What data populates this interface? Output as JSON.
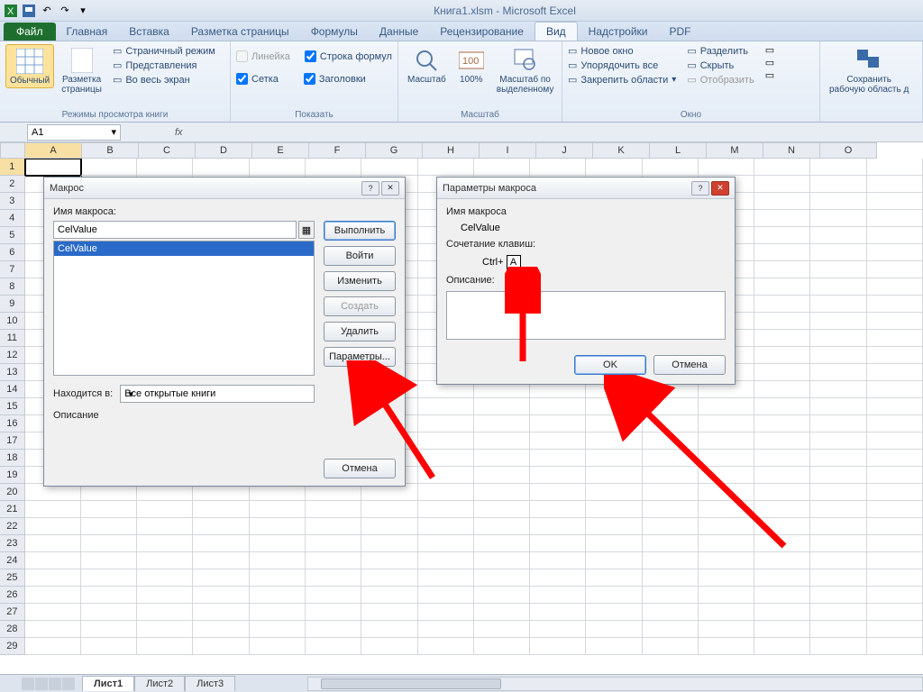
{
  "titlebar": {
    "title": "Книга1.xlsm  -  Microsoft Excel"
  },
  "tabs": {
    "file": "Файл",
    "items": [
      "Главная",
      "Вставка",
      "Разметка страницы",
      "Формулы",
      "Данные",
      "Рецензирование",
      "Вид",
      "Надстройки",
      "PDF"
    ],
    "active": "Вид"
  },
  "ribbon": {
    "views": {
      "normal": "Обычный",
      "pagelayout": "Разметка\nстраницы",
      "pagebreak": "Страничный режим",
      "custom": "Представления",
      "fullscreen": "Во весь экран",
      "group": "Режимы просмотра книги"
    },
    "show": {
      "ruler": "Линейка",
      "formulabar": "Строка формул",
      "gridlines": "Сетка",
      "headings": "Заголовки",
      "group": "Показать"
    },
    "zoom": {
      "zoom": "Масштаб",
      "hundred": "100%",
      "toselection": "Масштаб по\nвыделенному",
      "group": "Масштаб"
    },
    "window": {
      "neww": "Новое окно",
      "arrange": "Упорядочить все",
      "freeze": "Закрепить области",
      "split": "Разделить",
      "hide": "Скрыть",
      "unhide": "Отобразить",
      "save": "Сохранить\nрабочую область д",
      "group": "Окно"
    }
  },
  "namebox": "A1",
  "fx_label": "fx",
  "columns": [
    "A",
    "B",
    "C",
    "D",
    "E",
    "F",
    "G",
    "H",
    "I",
    "J",
    "K",
    "L",
    "M",
    "N",
    "O"
  ],
  "rownums": [
    1,
    2,
    3,
    4,
    5,
    6,
    7,
    8,
    9,
    10,
    11,
    12,
    13,
    14,
    15,
    16,
    17,
    18,
    19,
    20,
    21,
    22,
    23,
    24,
    25,
    26,
    27,
    28,
    29
  ],
  "sheets": [
    "Лист1",
    "Лист2",
    "Лист3"
  ],
  "macro_dialog": {
    "title": "Макрос",
    "name_label": "Имя макроса:",
    "name_value": "CelValue",
    "list_item": "CelValue",
    "run": "Выполнить",
    "stepinto": "Войти",
    "edit": "Изменить",
    "create": "Создать",
    "delete": "Удалить",
    "options": "Параметры...",
    "in_label": "Находится в:",
    "in_value": "Все открытые книги",
    "desc_label": "Описание",
    "cancel": "Отмена"
  },
  "opts_dialog": {
    "title": "Параметры макроса",
    "name_label": "Имя макроса",
    "name_value": "CelValue",
    "shortcut_label": "Сочетание клавиш:",
    "ctrl": "Ctrl+",
    "key": "A",
    "desc_label": "Описание:",
    "desc_value": "",
    "ok": "OK",
    "cancel": "Отмена"
  }
}
